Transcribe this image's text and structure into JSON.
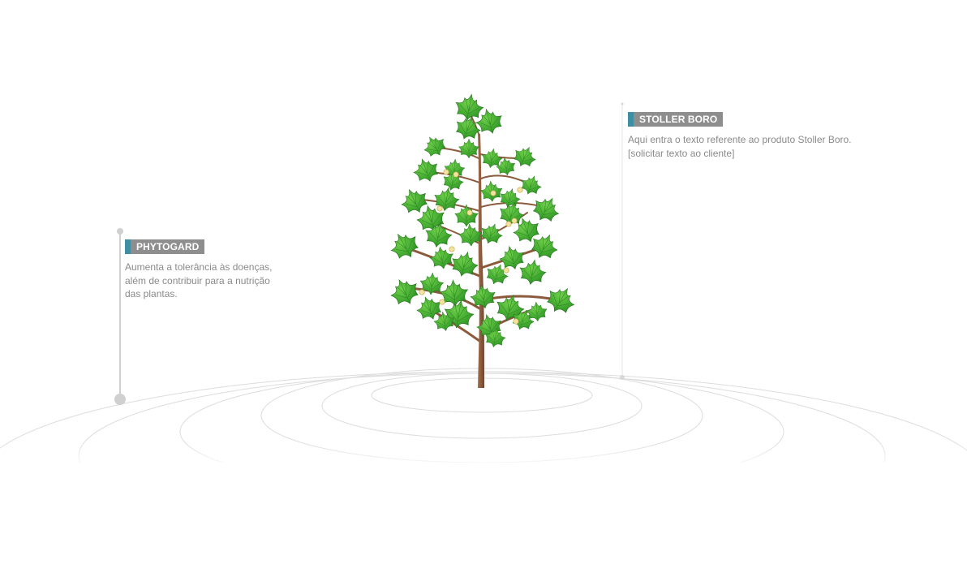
{
  "callouts": {
    "phytogard": {
      "label": "PHYTOGARD",
      "lines": [
        "Aumenta a tolerância às doenças,",
        "além de contribuir para a nutrição",
        "das plantas."
      ]
    },
    "stoller_boro": {
      "label": "STOLLER BORO",
      "lines": [
        "Aqui entra o texto referente ao produto Stoller Boro.",
        "[solicitar texto ao cliente]"
      ]
    }
  },
  "colors": {
    "label_bg": "#8e8e8e",
    "label_accent": "#3f8fa3",
    "body_text": "#8a8a8a",
    "ring_stroke": "#dcdcdc",
    "leaf_green": "#3fa32f",
    "trunk_brown": "#8b5a3c",
    "flower": "#f3e3a2"
  },
  "icons": {
    "tree": "cotton-plant-illustration",
    "marker": "callout-pin-dot"
  }
}
